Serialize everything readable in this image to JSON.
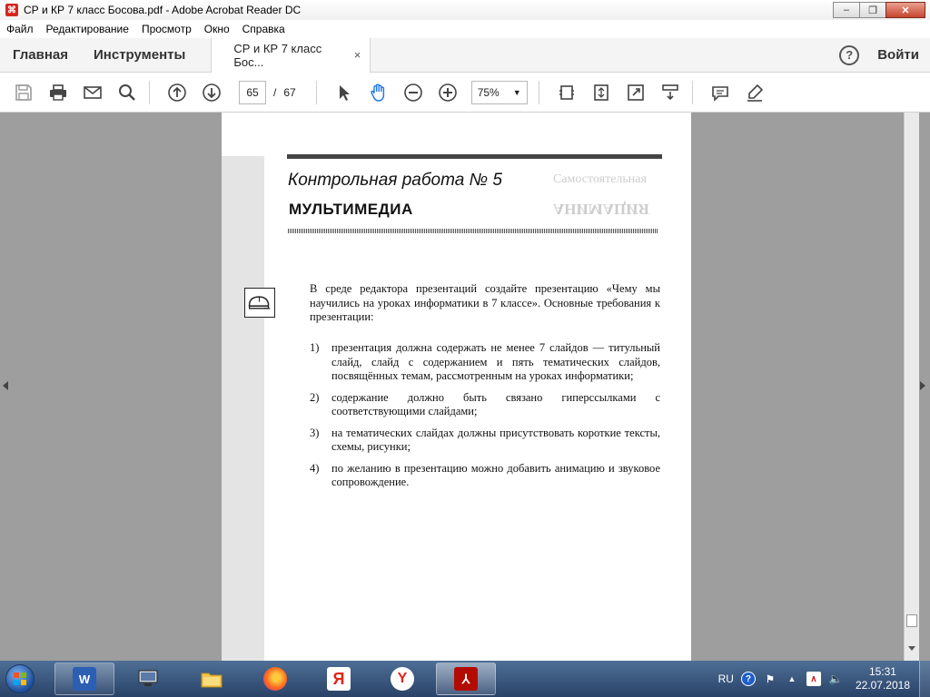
{
  "window": {
    "title": "СР и КР 7 класс Босова.pdf - Adobe Acrobat Reader DC",
    "minimize": "–",
    "maximize": "❐",
    "close": "✕"
  },
  "menu": [
    "Файл",
    "Редактирование",
    "Просмотр",
    "Окно",
    "Справка"
  ],
  "tabs": {
    "home": "Главная",
    "tools": "Инструменты",
    "document": "СР и КР 7 класс Бос...",
    "close": "×",
    "help": "?",
    "signin": "Войти"
  },
  "toolbar": {
    "page_current": "65",
    "page_separator": "/",
    "page_total": "67",
    "zoom": "75%"
  },
  "document": {
    "section_title": "Контрольная работа № 5",
    "section_heading": "МУЛЬТИМЕДИА",
    "intro": "В среде редактора презентаций создайте презентацию «Чему мы научились на уроках информатики в 7 классе». Основные требования к презентации:",
    "list": [
      {
        "num": "1)",
        "text": "презентация должна содержать не менее 7 слайдов — титульный слайд, слайд с содержанием и пять тематических слайдов, посвящённых темам, рассмотренным на уроках информатики;"
      },
      {
        "num": "2)",
        "text": "содержание должно быть связано гиперссылками с соответствующими слайдами;"
      },
      {
        "num": "3)",
        "text": "на тематических слайдах должны присутствовать короткие тексты, схемы, рисунки;"
      },
      {
        "num": "4)",
        "text": "по желанию в презентацию можно добавить анимацию и звуковое сопровождение."
      }
    ]
  },
  "taskbar": {
    "lang": "RU",
    "time": "15:31",
    "date": "22.07.2018"
  }
}
